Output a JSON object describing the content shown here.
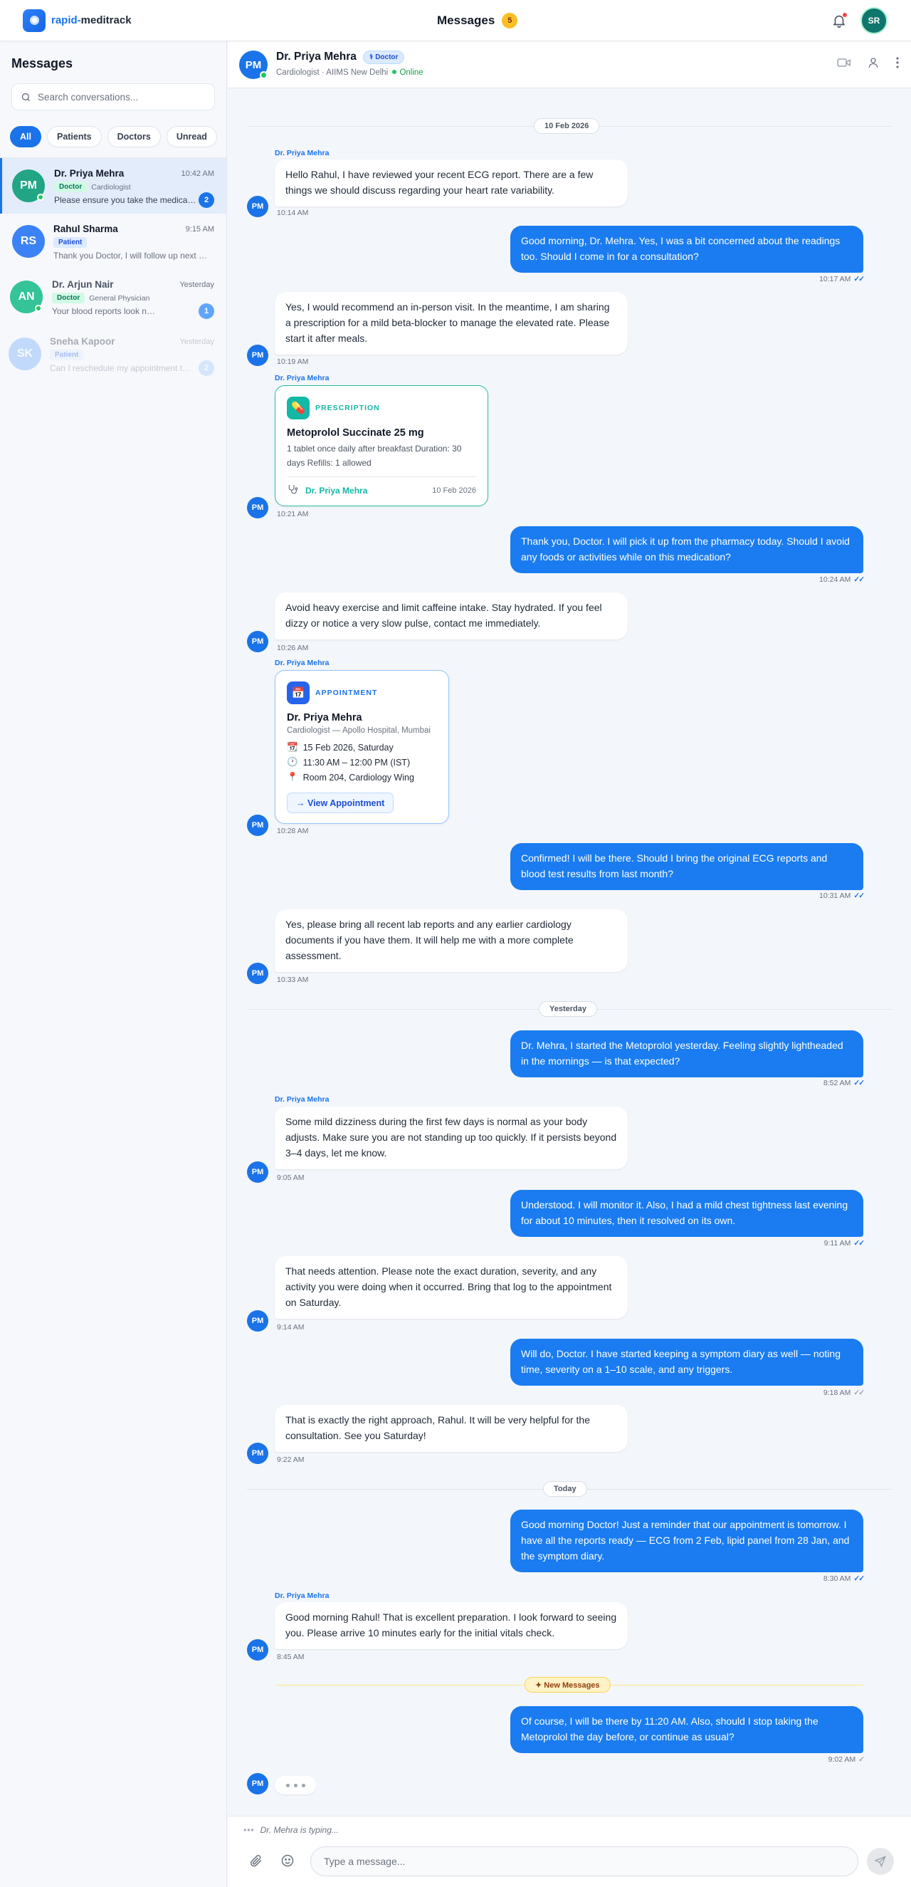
{
  "app": {
    "brand_a": "rapid-",
    "brand_b": "meditrack",
    "page_title": "Messages",
    "notif_count": "5",
    "user_initials": "SR"
  },
  "sidebar": {
    "title": "Messages",
    "search_placeholder": "Search conversations...",
    "filters": [
      "All",
      "Patients",
      "Doctors",
      "Unread"
    ],
    "conversations": [
      {
        "initials": "PM",
        "name": "Dr. Priya Mehra",
        "time": "10:42 AM",
        "tag": "Doctor",
        "spec": "Cardiologist",
        "preview": "Please ensure you take the medication with food",
        "unread": "2",
        "color": "#22a584"
      },
      {
        "initials": "RS",
        "name": "Rahul Sharma",
        "time": "9:15 AM",
        "tag": "Patient",
        "spec": "",
        "preview": "Thank you Doctor, I will follow up next week",
        "unread": "",
        "color": "#3b82f6"
      },
      {
        "initials": "AN",
        "name": "Dr. Arjun Nair",
        "time": "Yesterday",
        "tag": "Doctor",
        "spec": "General Physician",
        "preview": "Your blood reports look normal. Continue",
        "unread": "1",
        "color": "#22a584"
      },
      {
        "initials": "SK",
        "name": "Sneha Kapoor",
        "time": "Yesterday",
        "tag": "Patient",
        "spec": "",
        "preview": "Can I reschedule my appointment to Friday?",
        "unread": "2",
        "color": "#60a5fa"
      }
    ]
  },
  "chat": {
    "initials": "PM",
    "name": "Dr. Priya Mehra",
    "badge": "⚕ Doctor",
    "subtitle": "Cardiologist · AIIMS New Delhi",
    "status": "Online",
    "sender_label": "Dr. Priya Mehra",
    "dividers": {
      "d1": "10 Feb 2026",
      "d2": "Yesterday",
      "d3": "Today",
      "d4": "✦ New Messages"
    },
    "messages": {
      "m1": {
        "text": "Hello Rahul, I have reviewed your recent ECG report. There are a few things we should discuss regarding your heart rate variability.",
        "time": "10:14 AM"
      },
      "m2": {
        "text": "Good morning, Dr. Mehra. Yes, I was a bit concerned about the readings too. Should I come in for a consultation?",
        "time": "10:17 AM"
      },
      "m3": {
        "text": "Yes, I would recommend an in-person visit. In the meantime, I am sharing a prescription for a mild beta-blocker to manage the elevated rate. Please start it after meals.",
        "time": "10:19 AM"
      },
      "m4": {
        "time": "10:21 AM"
      },
      "m5": {
        "text": "Thank you, Doctor. I will pick it up from the pharmacy today. Should I avoid any foods or activities while on this medication?",
        "time": "10:24 AM"
      },
      "m6": {
        "text": "Avoid heavy exercise and limit caffeine intake. Stay hydrated. If you feel dizzy or notice a very slow pulse, contact me immediately.",
        "time": "10:26 AM"
      },
      "m7": {
        "time": "10:28 AM"
      },
      "m8": {
        "text": "Confirmed! I will be there. Should I bring the original ECG reports and blood test results from last month?",
        "time": "10:31 AM"
      },
      "m9": {
        "text": "Yes, please bring all recent lab reports and any earlier cardiology documents if you have them. It will help me with a more complete assessment.",
        "time": "10:33 AM"
      },
      "m10": {
        "text": "Dr. Mehra, I started the Metoprolol yesterday. Feeling slightly lightheaded in the mornings — is that expected?",
        "time": "8:52 AM"
      },
      "m11": {
        "text": "Some mild dizziness during the first few days is normal as your body adjusts. Make sure you are not standing up too quickly. If it persists beyond 3–4 days, let me know.",
        "time": "9:05 AM"
      },
      "m12": {
        "text": "Understood. I will monitor it. Also, I had a mild chest tightness last evening for about 10 minutes, then it resolved on its own.",
        "time": "9:11 AM"
      },
      "m13": {
        "text": "That needs attention. Please note the exact duration, severity, and any activity you were doing when it occurred. Bring that log to the appointment on Saturday.",
        "time": "9:14 AM"
      },
      "m14": {
        "text": "Will do, Doctor. I have started keeping a symptom diary as well — noting time, severity on a 1–10 scale, and any triggers.",
        "time": "9:18 AM"
      },
      "m15": {
        "text": "That is exactly the right approach, Rahul. It will be very helpful for the consultation. See you Saturday!",
        "time": "9:22 AM"
      },
      "m16": {
        "text": "Good morning Doctor! Just a reminder that our appointment is tomorrow. I have all the reports ready — ECG from 2 Feb, lipid panel from 28 Jan, and the symptom diary.",
        "time": "8:30 AM"
      },
      "m17": {
        "text": "Good morning Rahul! That is excellent preparation. I look forward to seeing you. Please arrive 10 minutes early for the initial vitals check.",
        "time": "8:45 AM"
      },
      "m18": {
        "text": "Of course, I will be there by 11:20 AM. Also, should I stop taking the Metoprolol the day before, or continue as usual?",
        "time": "9:02 AM"
      }
    },
    "prescription": {
      "label": "PRESCRIPTION",
      "medicine": "Metoprolol Succinate 25 mg",
      "details": "1 tablet once daily after breakfast Duration: 30 days Refills: 1 allowed",
      "doctor": "Dr. Priya Mehra",
      "date": "10 Feb 2026"
    },
    "appointment": {
      "label": "APPOINTMENT",
      "doctor": "Dr. Priya Mehra",
      "place": "Cardiologist — Apollo Hospital, Mumbai",
      "date": "15 Feb 2026, Saturday",
      "time": "11:30 AM – 12:00 PM (IST)",
      "room": "Room 204, Cardiology Wing",
      "button": "→ View Appointment"
    }
  },
  "composer": {
    "typing": "Dr. Mehra is typing...",
    "placeholder": "Type a message..."
  }
}
